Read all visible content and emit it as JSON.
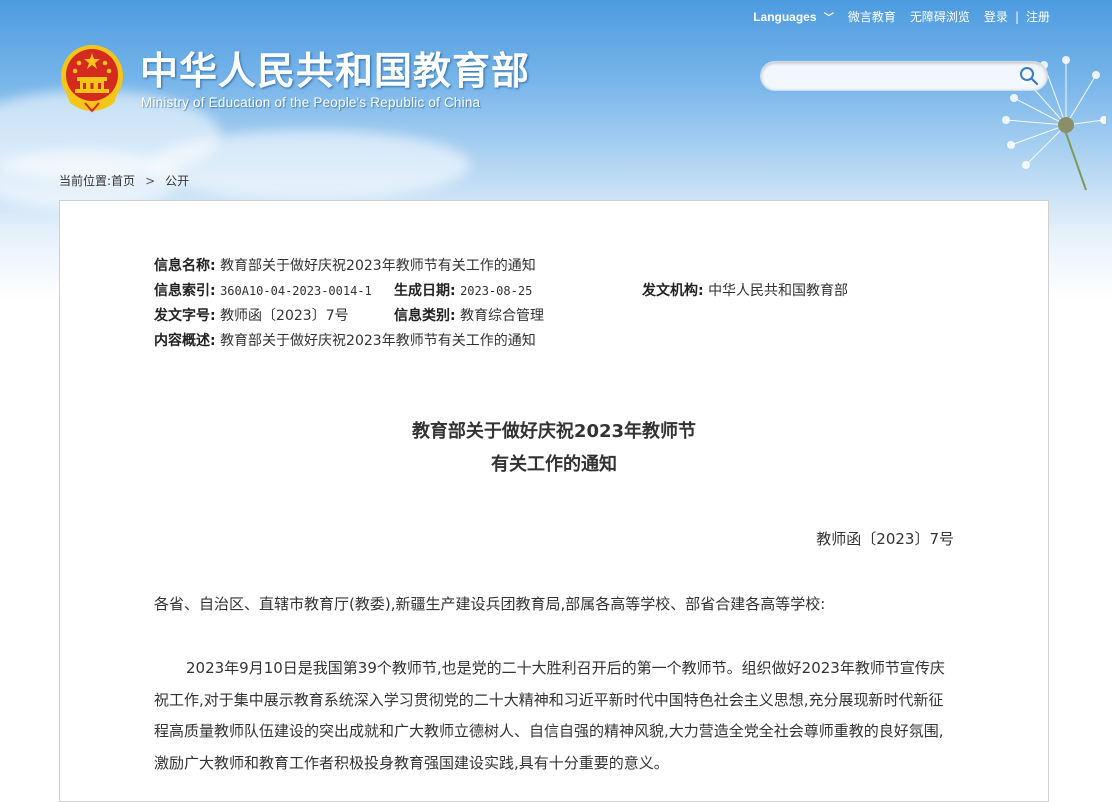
{
  "topbar": {
    "languages": "Languages",
    "weiyan": "微言教育",
    "accessible": "无障碍浏览",
    "login": "登录",
    "divider": "|",
    "register": "注册"
  },
  "site": {
    "title": "中华人民共和国教育部",
    "subtitle": "Ministry of Education of the People's Republic of China"
  },
  "search": {
    "placeholder": "",
    "value": ""
  },
  "breadcrumb": {
    "label": "当前位置:",
    "home": "首页",
    "current": "公开"
  },
  "meta": {
    "name_label": "信息名称:",
    "name_value": "教育部关于做好庆祝2023年教师节有关工作的通知",
    "index_label": "信息索引:",
    "index_value": "360A10-04-2023-0014-1",
    "date_label": "生成日期:",
    "date_value": "2023-08-25",
    "issuer_label": "发文机构:",
    "issuer_value": "中华人民共和国教育部",
    "docno_label": "发文字号:",
    "docno_value": "教师函〔2023〕7号",
    "category_label": "信息类别:",
    "category_value": "教育综合管理",
    "summary_label": "内容概述:",
    "summary_value": "教育部关于做好庆祝2023年教师节有关工作的通知"
  },
  "document": {
    "title_line1": "教育部关于做好庆祝2023年教师节",
    "title_line2": "有关工作的通知",
    "number": "教师函〔2023〕7号",
    "addressee": "各省、自治区、直辖市教育厅(教委),新疆生产建设兵团教育局,部属各高等学校、部省合建各高等学校:",
    "paragraph1": "2023年9月10日是我国第39个教师节,也是党的二十大胜利召开后的第一个教师节。组织做好2023年教师节宣传庆祝工作,对于集中展示教育系统深入学习贯彻党的二十大精神和习近平新时代中国特色社会主义思想,充分展现新时代新征程高质量教师队伍建设的突出成就和广大教师立德树人、自信自强的精神风貌,大力营造全党全社会尊师重教的良好氛围,激励广大教师和教育工作者积极投身教育强国建设实践,具有十分重要的意义。"
  },
  "colors": {
    "header_top": "#4d9be0",
    "emblem_red": "#d42a20",
    "emblem_gold": "#f5c518",
    "text": "#333333"
  }
}
